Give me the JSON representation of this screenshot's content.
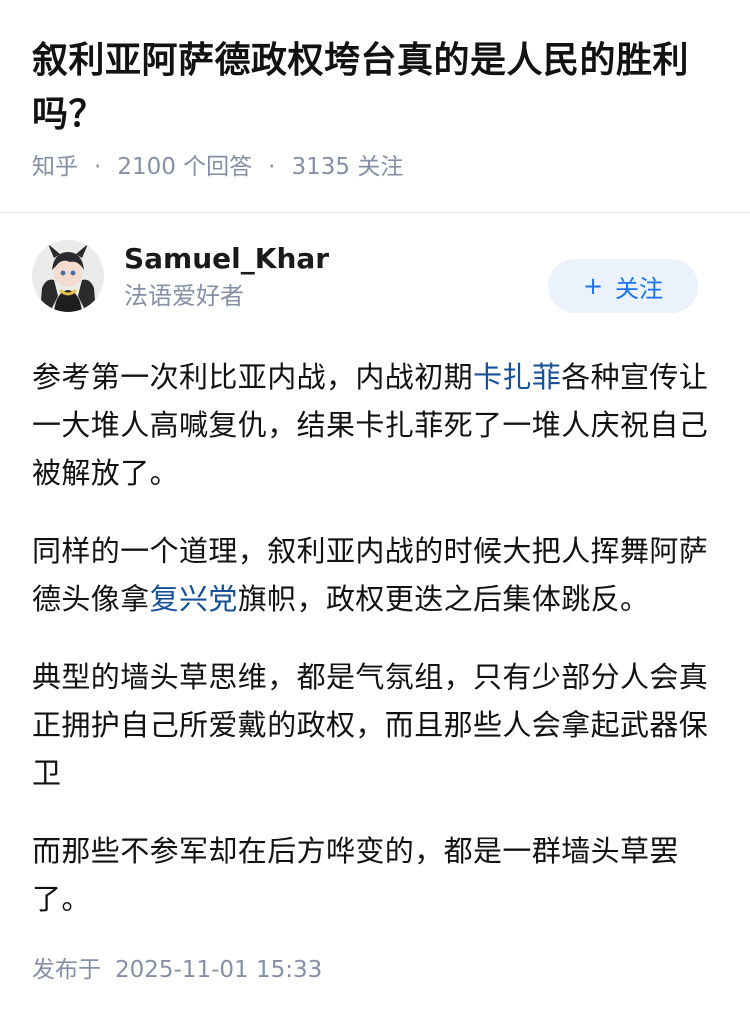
{
  "question": {
    "title": "叙利亚阿萨德政权垮台真的是人民的胜利吗？",
    "source": "知乎",
    "answers": "2100 个回答",
    "followers": "3135 关注"
  },
  "author": {
    "name": "Samuel_Khar",
    "bio": "法语爱好者",
    "follow_label": "关注",
    "follow_icon": "plus-icon"
  },
  "content": {
    "p1_a": "参考第一次利比亚内战，内战初期",
    "p1_link": "卡扎菲",
    "p1_b": "各种宣传让一大堆人高喊复仇，结果卡扎菲死了一堆人庆祝自己被解放了。",
    "p2_a": "同样的一个道理，叙利亚内战的时候大把人挥舞阿萨德头像拿",
    "p2_link": "复兴党",
    "p2_b": "旗帜，政权更迭之后集体跳反。",
    "p3": "典型的墙头草思维，都是气氛组，只有少部分人会真正拥护自己所爱戴的政权，而且那些人会拿起武器保卫",
    "p4": "而那些不参军却在后方哗变的，都是一群墙头草罢了。"
  },
  "footer": {
    "publish_label": "发布于",
    "publish_time": "2025-11-01 15:33"
  },
  "colors": {
    "link": "#175199",
    "accent": "#1772f6",
    "meta": "#8590a6"
  }
}
